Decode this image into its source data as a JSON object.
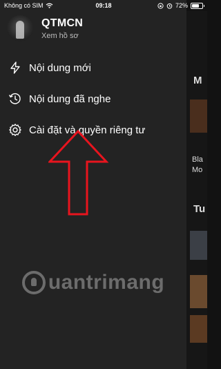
{
  "status_bar": {
    "carrier": "Không có SIM",
    "time": "09:18",
    "battery": "72%",
    "battery_level": 0.72
  },
  "profile": {
    "name": "QTMCN",
    "subtitle": "Xem hồ sơ"
  },
  "menu": {
    "items": [
      {
        "label": "Nội dung mới",
        "icon": "lightning-icon"
      },
      {
        "label": "Nội dung đã nghe",
        "icon": "clock-history-icon"
      },
      {
        "label": "Cài đặt và quyền riêng tư",
        "icon": "gear-icon"
      }
    ]
  },
  "background": {
    "strip_texts": [
      "M",
      "Bla",
      "Mo",
      "Tu"
    ]
  },
  "watermark": {
    "text": "uantrimang"
  },
  "colors": {
    "drawer_bg": "#232323",
    "arrow": "#e8141e"
  }
}
